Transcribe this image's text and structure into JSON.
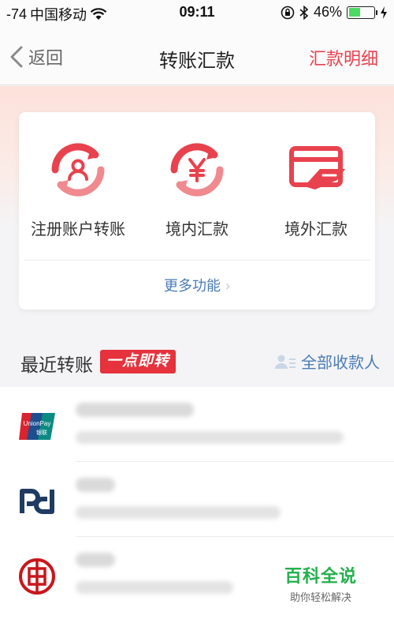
{
  "status_bar": {
    "signal": "-74",
    "carrier": "中国移动",
    "time": "09:11",
    "battery_percent_text": "46%",
    "battery_level": 0.46,
    "battery_color": "#4cd964"
  },
  "nav": {
    "back_label": "返回",
    "title": "转账汇款",
    "right_link": "汇款明细",
    "accent": "#e8424e"
  },
  "functions": [
    {
      "label": "注册账户转账",
      "icon": "registered-account-transfer-icon"
    },
    {
      "label": "境内汇款",
      "icon": "domestic-remittance-icon"
    },
    {
      "label": "境外汇款",
      "icon": "overseas-remittance-icon"
    }
  ],
  "more_label": "更多功能",
  "recent": {
    "title": "最近转账",
    "badge": "一点即转",
    "all_payees": "全部收款人",
    "rows": [
      {
        "bank_icon": "unionpay-logo"
      },
      {
        "bank_icon": "spdb-logo"
      },
      {
        "bank_icon": "icbc-logo"
      }
    ]
  },
  "watermark": {
    "title": "百科全说",
    "subtitle": "助你轻松解决"
  }
}
